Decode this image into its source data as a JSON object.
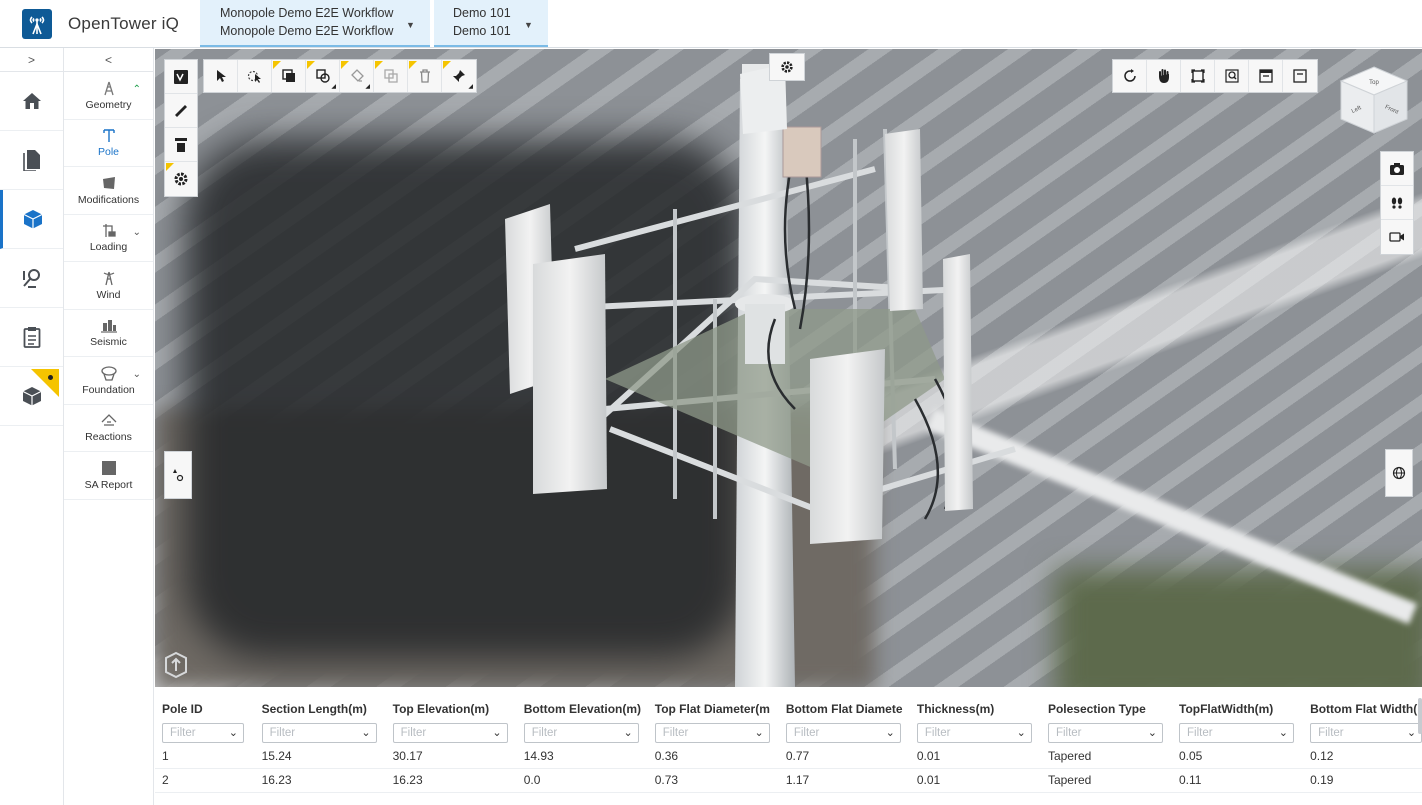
{
  "app": {
    "title": "OpenTower iQ"
  },
  "breadcrumbs": [
    {
      "line1": "Monopole Demo E2E Workflow",
      "line2": "Monopole Demo E2E Workflow"
    },
    {
      "line1": "Demo 101",
      "line2": "Demo 101"
    }
  ],
  "rail": {
    "toggle": ">",
    "items": [
      {
        "icon": "home-icon",
        "active": false
      },
      {
        "icon": "document-icon",
        "active": false
      },
      {
        "icon": "cube-icon",
        "active": true
      },
      {
        "icon": "inspection-icon",
        "active": false
      },
      {
        "icon": "clipboard-icon",
        "active": false
      },
      {
        "icon": "cube-flagged-icon",
        "active": false
      }
    ]
  },
  "panel": {
    "toggle": "<",
    "items": [
      {
        "label": "Geometry",
        "icon": "tower-icon",
        "chevron": "up"
      },
      {
        "label": "Pole",
        "icon": "pole-icon",
        "active": true
      },
      {
        "label": "Modifications",
        "icon": "modification-icon"
      },
      {
        "label": "Loading",
        "icon": "loading-icon",
        "chevron": "down"
      },
      {
        "label": "Wind",
        "icon": "wind-icon"
      },
      {
        "label": "Seismic",
        "icon": "seismic-icon"
      },
      {
        "label": "Foundation",
        "icon": "foundation-icon",
        "chevron": "down"
      },
      {
        "label": "Reactions",
        "icon": "reactions-icon"
      },
      {
        "label": "SA Report",
        "icon": "report-icon"
      }
    ]
  },
  "viewport": {
    "top_toolbar": [
      "select-icon",
      "multi-select-icon",
      "copy-layer-icon",
      "shape-select-icon",
      "paint-icon",
      "duplicate-icon",
      "delete-icon",
      "pin-icon"
    ],
    "left_toolbar": [
      "tag-icon",
      "measure-icon",
      "filter-icon",
      "settings-icon"
    ],
    "right_toolbar": [
      "rotate-icon",
      "pan-icon",
      "fit-icon",
      "zoom-icon",
      "panel-top-icon",
      "panel-bottom-icon"
    ],
    "side_toolbar": [
      "camera-icon",
      "footsteps-icon",
      "video-icon"
    ],
    "viewcube_faces": {
      "top": "Top",
      "left": "Left",
      "front": "Front"
    }
  },
  "table": {
    "columns": [
      "Pole ID",
      "Section Length(m)",
      "Top Elevation(m)",
      "Bottom Elevation(m)",
      "Top Flat Diameter(m",
      "Bottom Flat Diamete",
      "Thickness(m)",
      "Polesection Type",
      "TopFlatWidth(m)",
      "Bottom Flat Width(n"
    ],
    "filter_placeholder": "Filter",
    "rows": [
      [
        "1",
        "15.24",
        "30.17",
        "14.93",
        "0.36",
        "0.77",
        "0.01",
        "Tapered",
        "0.05",
        "0.12"
      ],
      [
        "2",
        "16.23",
        "16.23",
        "0.0",
        "0.73",
        "1.17",
        "0.01",
        "Tapered",
        "0.11",
        "0.19"
      ]
    ]
  }
}
